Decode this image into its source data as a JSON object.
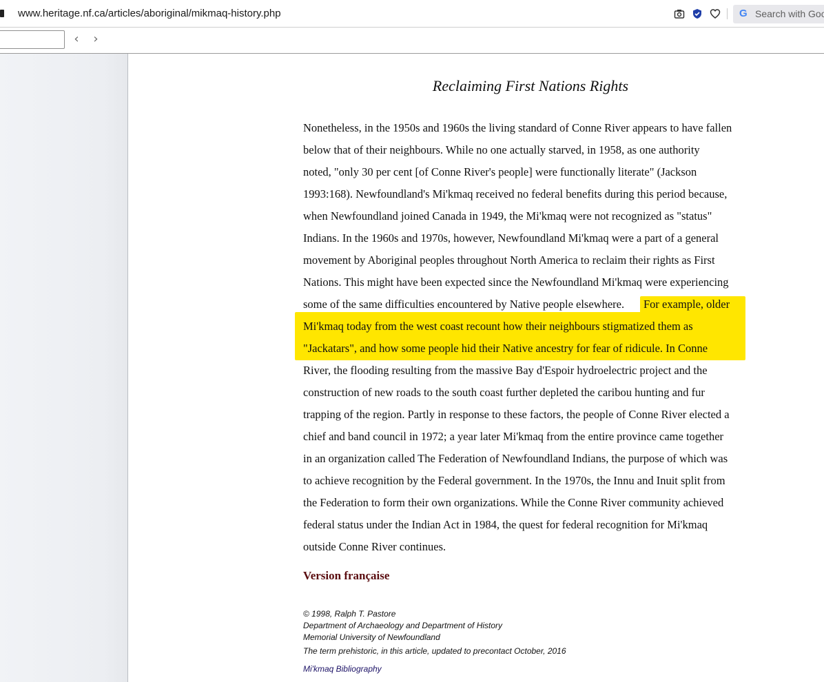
{
  "browser": {
    "url": "www.heritage.nf.ca/articles/aboriginal/mikmaq-history.php",
    "search_placeholder": "Search with Goog"
  },
  "findbar": {
    "value": "",
    "prev_glyph": "‹",
    "next_glyph": "›"
  },
  "article": {
    "title": "Reclaiming First Nations Rights",
    "lines": [
      "Nonetheless, in the 1950s and 1960s the living standard of Conne River appears to have fallen",
      "below that of their neighbours. While no one actually starved, in 1958, as one authority",
      "noted, \"only 30 per cent [of Conne River's people] were functionally literate\" (Jackson",
      "1993:168). Newfoundland's Mi'kmaq received no federal benefits during this period because,",
      "when Newfoundland joined Canada in 1949, the Mi'kmaq were not recognized as \"status\"",
      "Indians. In the 1960s and 1970s, however, Newfoundland Mi'kmaq were a part of a general",
      "movement by Aboriginal peoples throughout North America to reclaim their rights as First",
      "Nations. This might have been expected since the Newfoundland Mi'kmaq were experiencing",
      "some of the same difficulties encountered by Native people elsewhere.",
      "For example, older",
      "Mi'kmaq today from the west coast recount how their neighbours stigmatized them as",
      "\"Jackatars\", and how some people hid their Native ancestry for fear of ridicule. In Conne",
      "River, the flooding resulting from the massive Bay d'Espoir hydroelectric project and the",
      "construction of new roads to the south coast further depleted the caribou hunting and fur",
      "trapping of the region. Partly in response to these factors, the people of Conne River elected a",
      "chief and band council in 1972; a year later Mi'kmaq from the entire province came together",
      "in an organization called The Federation of Newfoundland Indians, the purpose of which was",
      "to achieve recognition by the Federal government. In the 1970s, the Innu and Inuit split from",
      "the Federation to form their own organizations. While the Conne River community achieved",
      "federal status under the Indian Act in 1984, the quest for federal recognition for Mi'kmaq",
      "outside Conne River continues."
    ],
    "version_link": "Version française",
    "footer": {
      "copyright": "© 1998, Ralph T. Pastore",
      "department": "Department of Archaeology and Department of History",
      "university": "Memorial University of Newfoundland",
      "note": "The term prehistoric, in this article, updated to precontact October, 2016",
      "bibliography_link": "Mi'kmaq Bibliography"
    }
  },
  "colors": {
    "highlight": "#ffe600",
    "version_link": "#5a0d10",
    "bibliography_link": "#1c1266"
  }
}
